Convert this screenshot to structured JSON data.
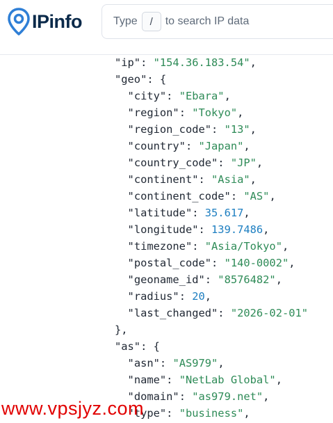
{
  "header": {
    "logo_text": "IPinfo",
    "search_prefix": "Type",
    "search_key": "/",
    "search_suffix": "to search IP data"
  },
  "json": {
    "ip": "\"154.36.183.54\"",
    "geo": {
      "city": "\"Ebara\"",
      "region": "\"Tokyo\"",
      "region_code": "\"13\"",
      "country": "\"Japan\"",
      "country_code": "\"JP\"",
      "continent": "\"Asia\"",
      "continent_code": "\"AS\"",
      "latitude": "35.617",
      "longitude": "139.7486",
      "timezone": "\"Asia/Tokyo\"",
      "postal_code": "\"140-0002\"",
      "geoname_id": "\"8576482\"",
      "radius": "20",
      "last_changed": "\"2026-02-01\""
    },
    "as": {
      "asn": "\"AS979\"",
      "name": "\"NetLab Global\"",
      "domain": "\"as979.net\"",
      "type": "\"business\""
    }
  },
  "keys": {
    "ip": "\"ip\"",
    "geo": "\"geo\"",
    "city": "\"city\"",
    "region": "\"region\"",
    "region_code": "\"region_code\"",
    "country": "\"country\"",
    "country_code": "\"country_code\"",
    "continent": "\"continent\"",
    "continent_code": "\"continent_code\"",
    "latitude": "\"latitude\"",
    "longitude": "\"longitude\"",
    "timezone": "\"timezone\"",
    "postal_code": "\"postal_code\"",
    "geoname_id": "\"geoname_id\"",
    "radius": "\"radius\"",
    "last_changed": "\"last_changed\"",
    "as": "\"as\"",
    "asn": "\"asn\"",
    "name": "\"name\"",
    "domain": "\"domain\"",
    "type": "\"type\""
  },
  "watermark": "www.vpsjyz.com",
  "colors": {
    "brand": "#0b2a4a",
    "accent": "#2f7fd6",
    "string": "#2e8b57",
    "number": "#1e7fc1",
    "watermark": "#e10000"
  }
}
